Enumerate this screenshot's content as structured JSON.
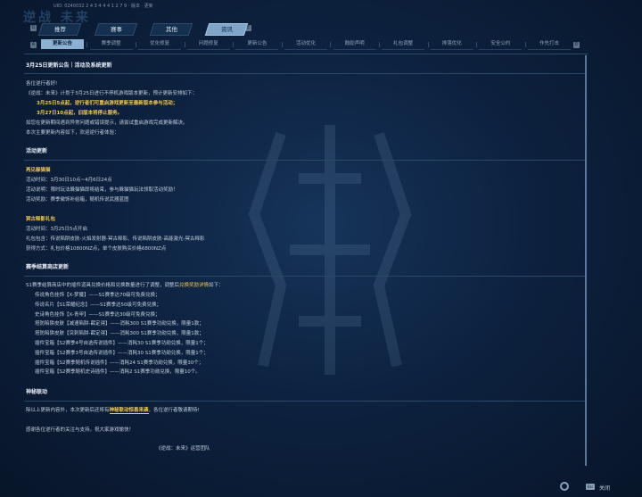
{
  "header": {
    "logo": "逆战 未来",
    "uid": "UID: 0240032 2 4 3 4 4 4 1 2 7 9 · 版本 · 更新"
  },
  "main_tabs": [
    {
      "label": "推荐",
      "active": false
    },
    {
      "label": "赛事",
      "active": false
    },
    {
      "label": "其他",
      "active": false
    },
    {
      "label": "资讯",
      "active": true
    }
  ],
  "left_btn": "Q",
  "right_btn": "E",
  "sub_tabs": [
    {
      "label": "更新公告",
      "active": true
    },
    {
      "label": "赛季调整",
      "active": false
    },
    {
      "label": "优化修复",
      "active": false
    },
    {
      "label": "问题修复",
      "active": false
    },
    {
      "label": "更新公告",
      "active": false
    },
    {
      "label": "活动优化",
      "active": false
    },
    {
      "label": "鼓励声明",
      "active": false
    },
    {
      "label": "礼包调整",
      "active": false
    },
    {
      "label": "排落优化",
      "active": false
    },
    {
      "label": "安全公约",
      "active": false
    },
    {
      "label": "作先打击",
      "active": false
    }
  ],
  "sub_left_btn": "A",
  "sub_right_btn": "D",
  "article": {
    "title": "3月25日更新公告｜活动及系统更新",
    "greeting": "各位逆行者好!",
    "p1": "《逆战：未来》计划于3月25日进行不停机游戏版本更新，预计更新安排如下：",
    "p2": "3月25日5点起，逆行者们可重启游戏更新至最新版本参与活动；",
    "p3": "3月27日10点起，旧版本将停止服务。",
    "p4": "如您在更新期间遇到异常问题或错误提示，请尝试重启游戏完成更新解决。",
    "p5": "本次主要更新内容如下，欢迎逆行者体验：",
    "s1": "活动更新",
    "a1_title": "再见躲猫猫",
    "a1_time": "活动时间：3月30日10点~4月6日24点",
    "a1_desc": "活动说明：限时玩法躲猫猫即将结束，参与躲猫猫玩法领取活动奖励！",
    "a1_reward": "活动奖励：赛季徽饰补给箱，随机传说武器蓝图",
    "a2_title": "冥古释影礼包",
    "a2_time": "活动时间：3月25日5点开启",
    "a2_content": "礼包包含：传说陷阱皮肤-火焰发射器-冥古释影、传说陷阱皮肤-高能激光-冥古释影",
    "a2_price": "获得方式：礼包价格10800NZ点，单个皮肤购买价格6800NZ点",
    "s2": "赛季结算商店更新",
    "shop_intro_a": "S1赛季结算商店中的插件道具兑换价格和兑换数量进行了调整，调整后",
    "shop_intro_b": "兑换奖励详情",
    "shop_intro_c": "如下：",
    "shop_items": [
      "传说角色挂饰【X-梦魇】——S1赛季达70级可免费兑换；",
      "传说名片【S1荣耀纪念】——S1赛季达50级可免费兑换；",
      "史诗角色挂饰【X-青甲】——S1赛季达30级可免费兑换；",
      "塔防陷阱皮肤【减速陷阱-薛定谔】——消耗300 S1赛季功勋兑换，限量1款；",
      "塔防陷阱皮肤【突刺陷阱-薛定谔】——消耗300 S1赛季功勋兑换，限量1款；",
      "插件宝箱【S2赛季4号自选传说插件】——消耗30 S1赛季功勋兑换，限量1个；",
      "插件宝箱【S2赛季3号自选传说插件】——消耗30 S1赛季功勋兑换，限量1个；",
      "插件宝箱【S2赛季随机传说插件】——消耗24 S1赛季功勋兑换，限量30个；",
      "插件宝箱【S2赛季随机史诗插件】——消耗2 S1赛季功勋兑换，限量10个。"
    ],
    "s3": "神秘联动",
    "mystery_a": "除以上更新内容外，本次更新后还将有",
    "mystery_b": "神秘联动惊喜来袭",
    "mystery_c": "，各位逆行者敬请期待!",
    "thanks": "感谢各位逆行者的关注与支持，祝大家游戏愉快！",
    "signature": "《逆战：未来》运营团队"
  },
  "footer": {
    "esc_key": "Esc",
    "close_label": "关闭"
  }
}
